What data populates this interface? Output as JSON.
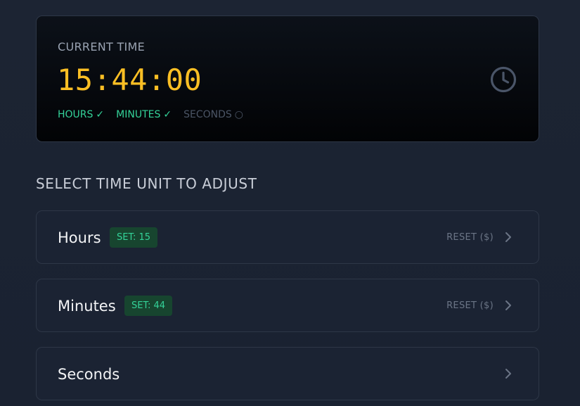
{
  "current_time": {
    "label": "CURRENT TIME",
    "value": "15:44:00",
    "units": [
      {
        "label": "HOURS",
        "mark": "✓",
        "status": "done"
      },
      {
        "label": "MINUTES",
        "mark": "✓",
        "status": "done"
      },
      {
        "label": "SECONDS",
        "mark": "○",
        "status": "pending"
      }
    ],
    "icon": "clock-icon"
  },
  "section_title": "SELECT TIME UNIT TO ADJUST",
  "unit_rows": [
    {
      "name": "Hours",
      "badge": "SET: 15",
      "reset": "RESET ($)",
      "icon": "chevron-right-icon"
    },
    {
      "name": "Minutes",
      "badge": "SET: 44",
      "reset": "RESET ($)",
      "icon": "chevron-right-icon"
    },
    {
      "name": "Seconds",
      "badge": "",
      "reset": "",
      "icon": "chevron-right-icon"
    }
  ],
  "colors": {
    "accent_time": "#fbbf24",
    "done": "#34d399",
    "pending": "#4b5565",
    "badge_bg": "#17452f"
  }
}
